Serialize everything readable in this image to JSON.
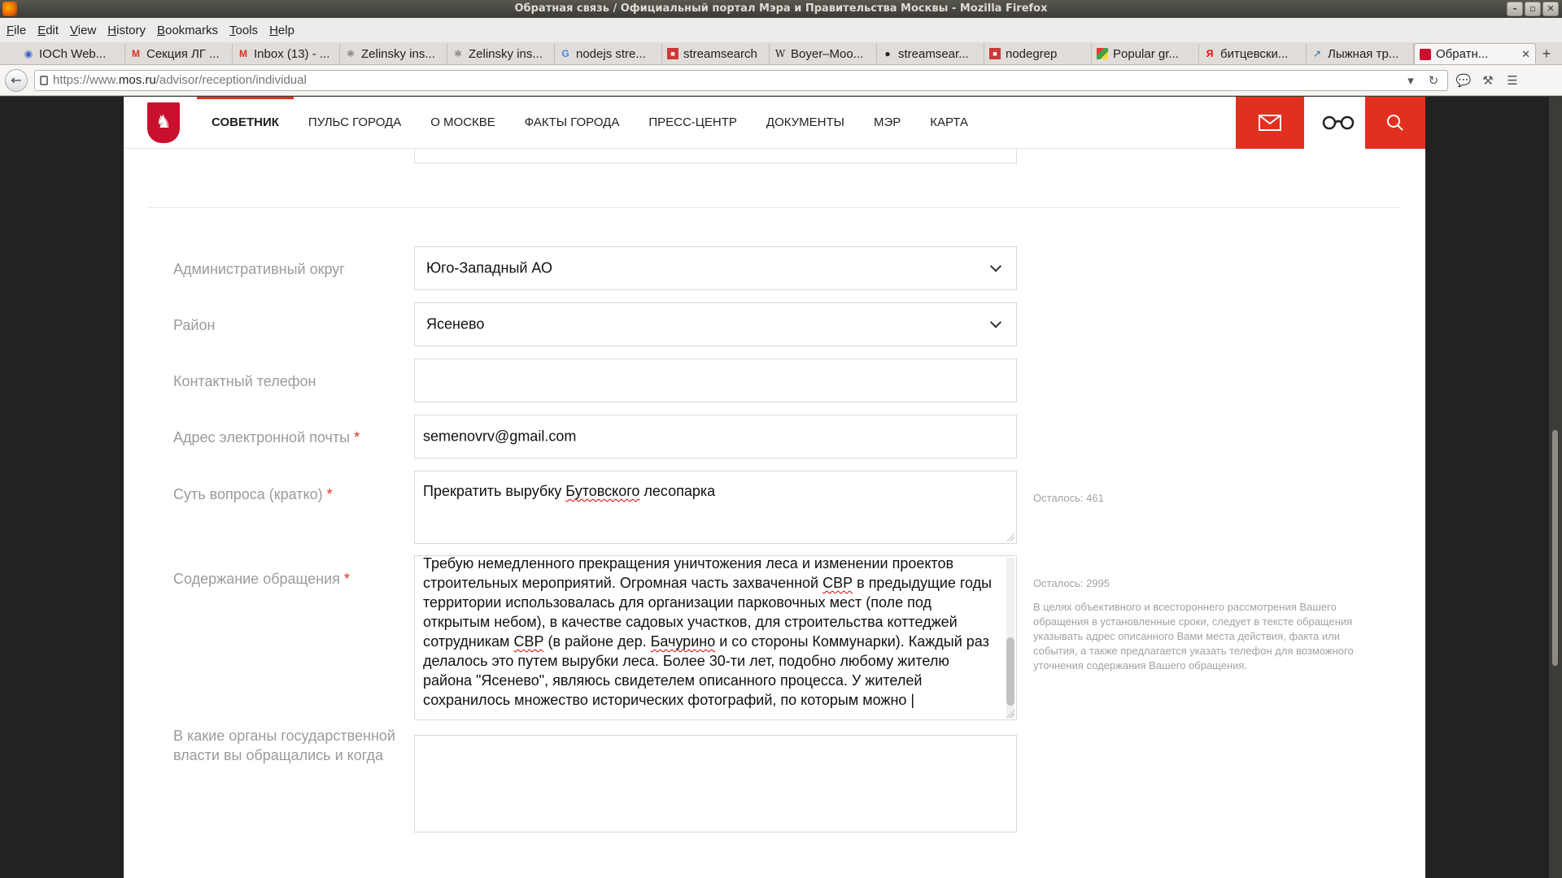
{
  "window": {
    "title": "Обратная связь / Официальный портал Мэра и Правительства Москвы - Mozilla Firefox"
  },
  "menu": [
    "File",
    "Edit",
    "View",
    "History",
    "Bookmarks",
    "Tools",
    "Help"
  ],
  "tabs": [
    {
      "label": "IOCh Web...",
      "icon": "eye-icon"
    },
    {
      "label": "Секция ЛГ ...",
      "icon": "gmail-icon"
    },
    {
      "label": "Inbox (13) - ...",
      "icon": "gmail-icon"
    },
    {
      "label": "Zelinsky ins...",
      "icon": "atom-icon"
    },
    {
      "label": "Zelinsky ins...",
      "icon": "atom-icon"
    },
    {
      "label": "nodejs stre...",
      "icon": "google-icon"
    },
    {
      "label": "streamsearch",
      "icon": "npm-icon"
    },
    {
      "label": "Boyer–Moo...",
      "icon": "wikipedia-icon"
    },
    {
      "label": "streamsear...",
      "icon": "github-icon"
    },
    {
      "label": "nodegrep",
      "icon": "npm-icon"
    },
    {
      "label": "Popular gr...",
      "icon": "flag-icon"
    },
    {
      "label": "битцевски...",
      "icon": "yandex-icon"
    },
    {
      "label": "Лыжная тр...",
      "icon": "ski-icon"
    },
    {
      "label": "Обратн...",
      "icon": "moscow-icon",
      "active": true
    }
  ],
  "url": {
    "prefix": "https://www.",
    "host": "mos.ru",
    "path": "/advisor/reception/individual"
  },
  "site": {
    "nav": [
      "СОВЕТНИК",
      "ПУЛЬС ГОРОДА",
      "О МОСКВЕ",
      "ФАКТЫ ГОРОДА",
      "ПРЕСС-ЦЕНТР",
      "ДОКУМЕНТЫ",
      "МЭР",
      "КАРТА"
    ],
    "accent": "#e1301f"
  },
  "form": {
    "district_label": "Административный округ",
    "district_value": "Юго-Западный АО",
    "area_label": "Район",
    "area_value": "Ясенево",
    "phone_label": "Контактный телефон",
    "phone_value": "",
    "email_label": "Адрес электронной почты",
    "email_value": "semenovrv@gmail.com",
    "subject_label": "Суть вопроса (кратко)",
    "subject_remaining": "Осталось: 461",
    "content_label": "Содержание обращения",
    "content_remaining": "Осталось: 2995",
    "content_hint": "В целях объективного и всестороннего рассмотрения Вашего обращения в установленные сроки, следует в тексте обращения указывать адрес описанного Вами места действия, факта или события, а также предлагается указать телефон для возможного уточнения содержания Вашего обращения.",
    "prior_label": "В какие органы государственной власти вы обращались и когда",
    "required_mark": "*"
  }
}
